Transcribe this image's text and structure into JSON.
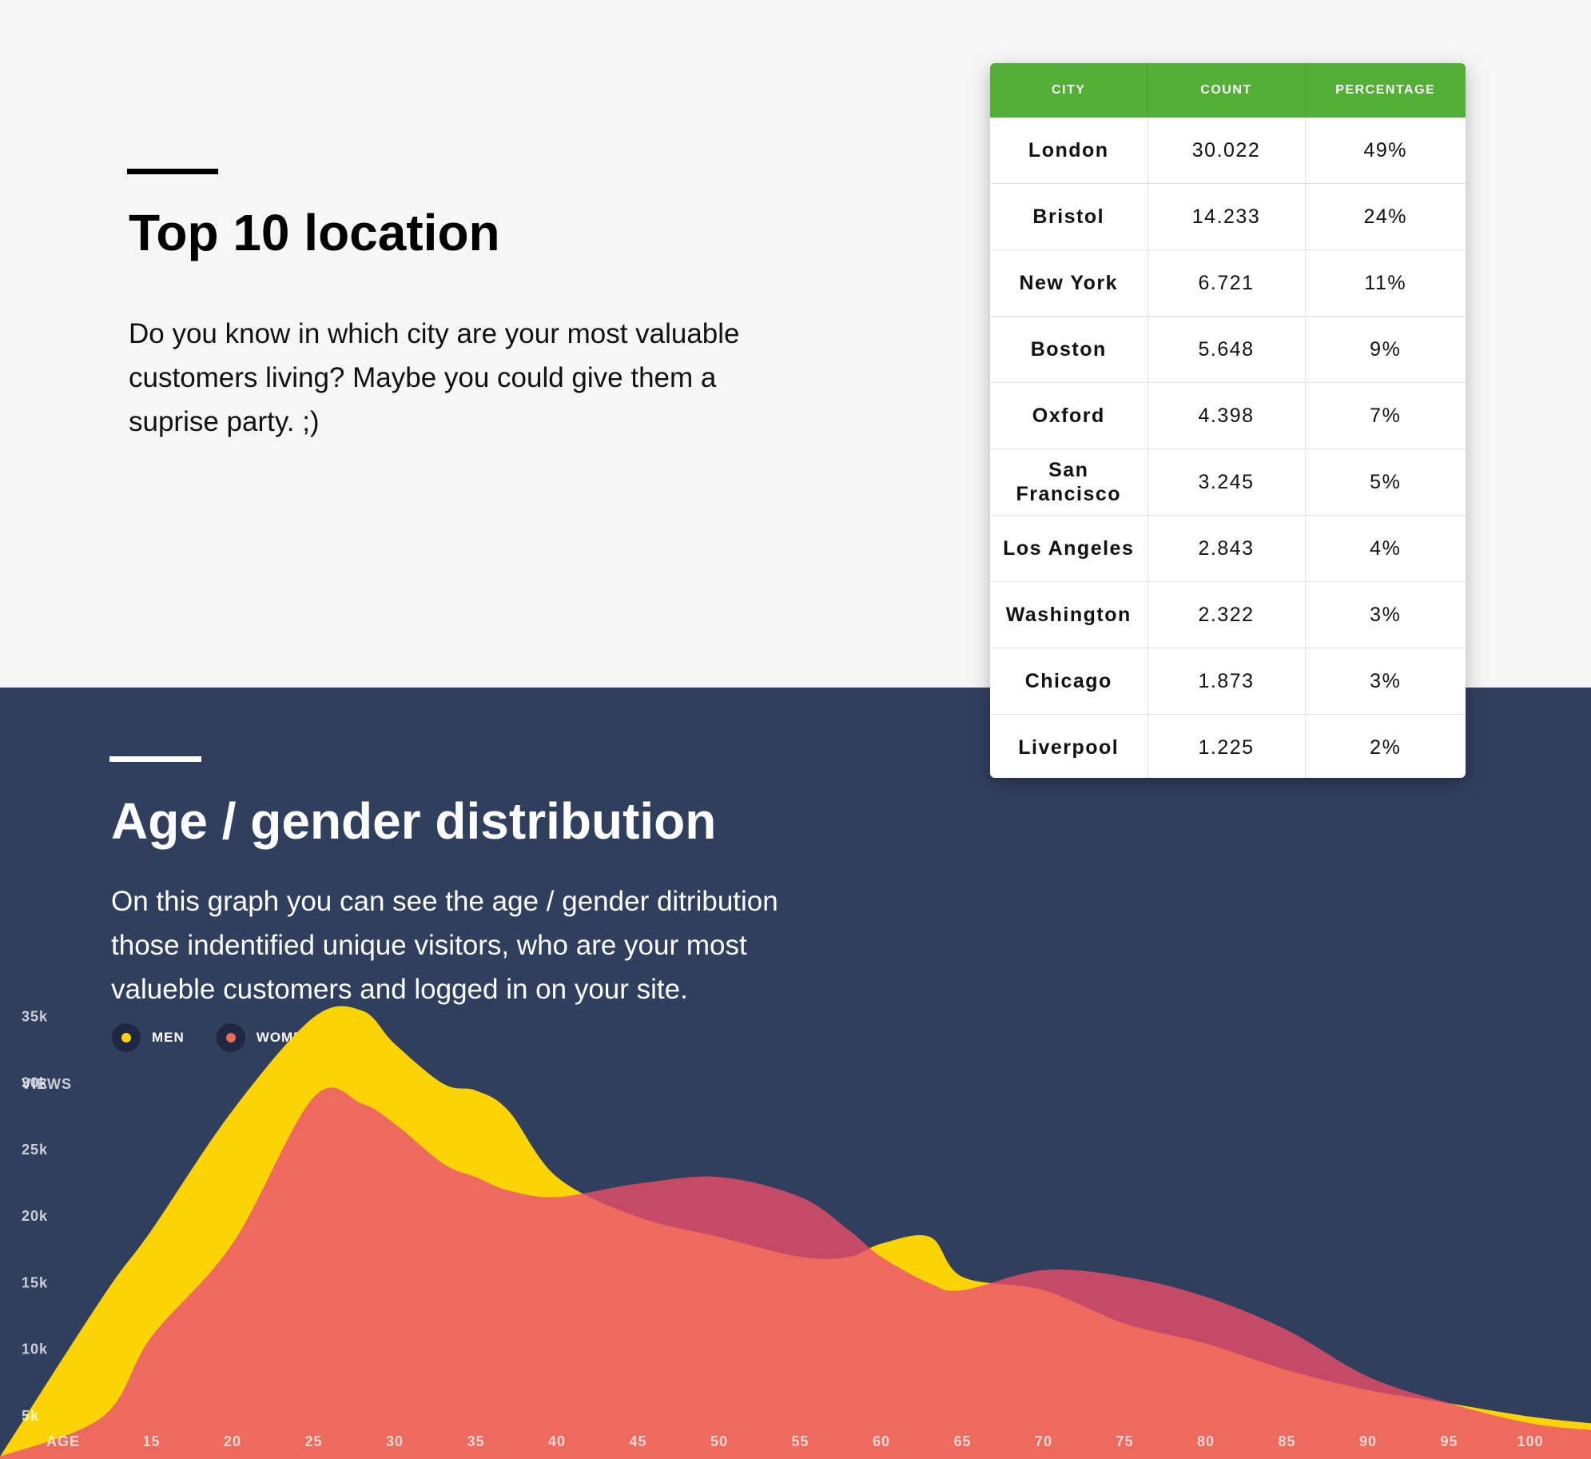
{
  "top": {
    "title": "Top 10 location",
    "description": "Do you know in which city are your most valuable customers living? Maybe you could give them a suprise party. ;)"
  },
  "table": {
    "headers": [
      "CITY",
      "COUNT",
      "PERCENTAGE"
    ],
    "rows": [
      {
        "city": "London",
        "count": "30.022",
        "percentage": "49%"
      },
      {
        "city": "Bristol",
        "count": "14.233",
        "percentage": "24%"
      },
      {
        "city": "New York",
        "count": "6.721",
        "percentage": "11%"
      },
      {
        "city": "Boston",
        "count": "5.648",
        "percentage": "9%"
      },
      {
        "city": "Oxford",
        "count": "4.398",
        "percentage": "7%"
      },
      {
        "city": "San Francisco",
        "count": "3.245",
        "percentage": "5%"
      },
      {
        "city": "Los Angeles",
        "count": "2.843",
        "percentage": "4%"
      },
      {
        "city": "Washington",
        "count": "2.322",
        "percentage": "3%"
      },
      {
        "city": "Chicago",
        "count": "1.873",
        "percentage": "3%"
      },
      {
        "city": "Liverpool",
        "count": "1.225",
        "percentage": "2%"
      }
    ]
  },
  "bottom": {
    "title": "Age / gender distribution",
    "description": "On this graph you can see the age / gender ditribution those indentified unique visitors, who are your most valueble customers and logged in on your site."
  },
  "legend": {
    "men": {
      "label": "MEN",
      "color": "#fcd404"
    },
    "women": {
      "label": "WOMEN",
      "color": "#ee6a5e"
    }
  },
  "colors": {
    "header_green": "#54ae38",
    "dark_navy": "#313f5f",
    "overlap": "#c44a66"
  },
  "chart_data": {
    "type": "area",
    "ylabel": "VIEWS",
    "xlabel": "AGE",
    "y_ticks": [
      "5k",
      "10k",
      "15k",
      "20k",
      "25k",
      "30k",
      "35k"
    ],
    "x_ticks": [
      "15",
      "20",
      "25",
      "30",
      "35",
      "40",
      "45",
      "50",
      "55",
      "60",
      "65",
      "70",
      "75",
      "80",
      "85",
      "90",
      "95",
      "100"
    ],
    "ylim": [
      0,
      35000
    ],
    "x": [
      10,
      12,
      15,
      20,
      25,
      28,
      30,
      33,
      35,
      37,
      40,
      45,
      50,
      55,
      58,
      60,
      63,
      65,
      70,
      75,
      80,
      85,
      90,
      95,
      100,
      103
    ],
    "series": [
      {
        "name": "MEN",
        "values": [
          0,
          12000,
          17000,
          26000,
          33000,
          33500,
          31000,
          28000,
          27500,
          26000,
          21000,
          18000,
          16500,
          15000,
          15000,
          16000,
          16500,
          13500,
          12500,
          10000,
          8500,
          6500,
          5000,
          4000,
          3000,
          2500
        ]
      },
      {
        "name": "WOMEN",
        "values": [
          0,
          3000,
          9000,
          16000,
          27000,
          26500,
          25000,
          22000,
          21000,
          20000,
          19500,
          20500,
          21000,
          19500,
          17000,
          15000,
          13000,
          12500,
          14000,
          13500,
          12000,
          9500,
          6000,
          4000,
          2500,
          2000
        ]
      }
    ]
  }
}
